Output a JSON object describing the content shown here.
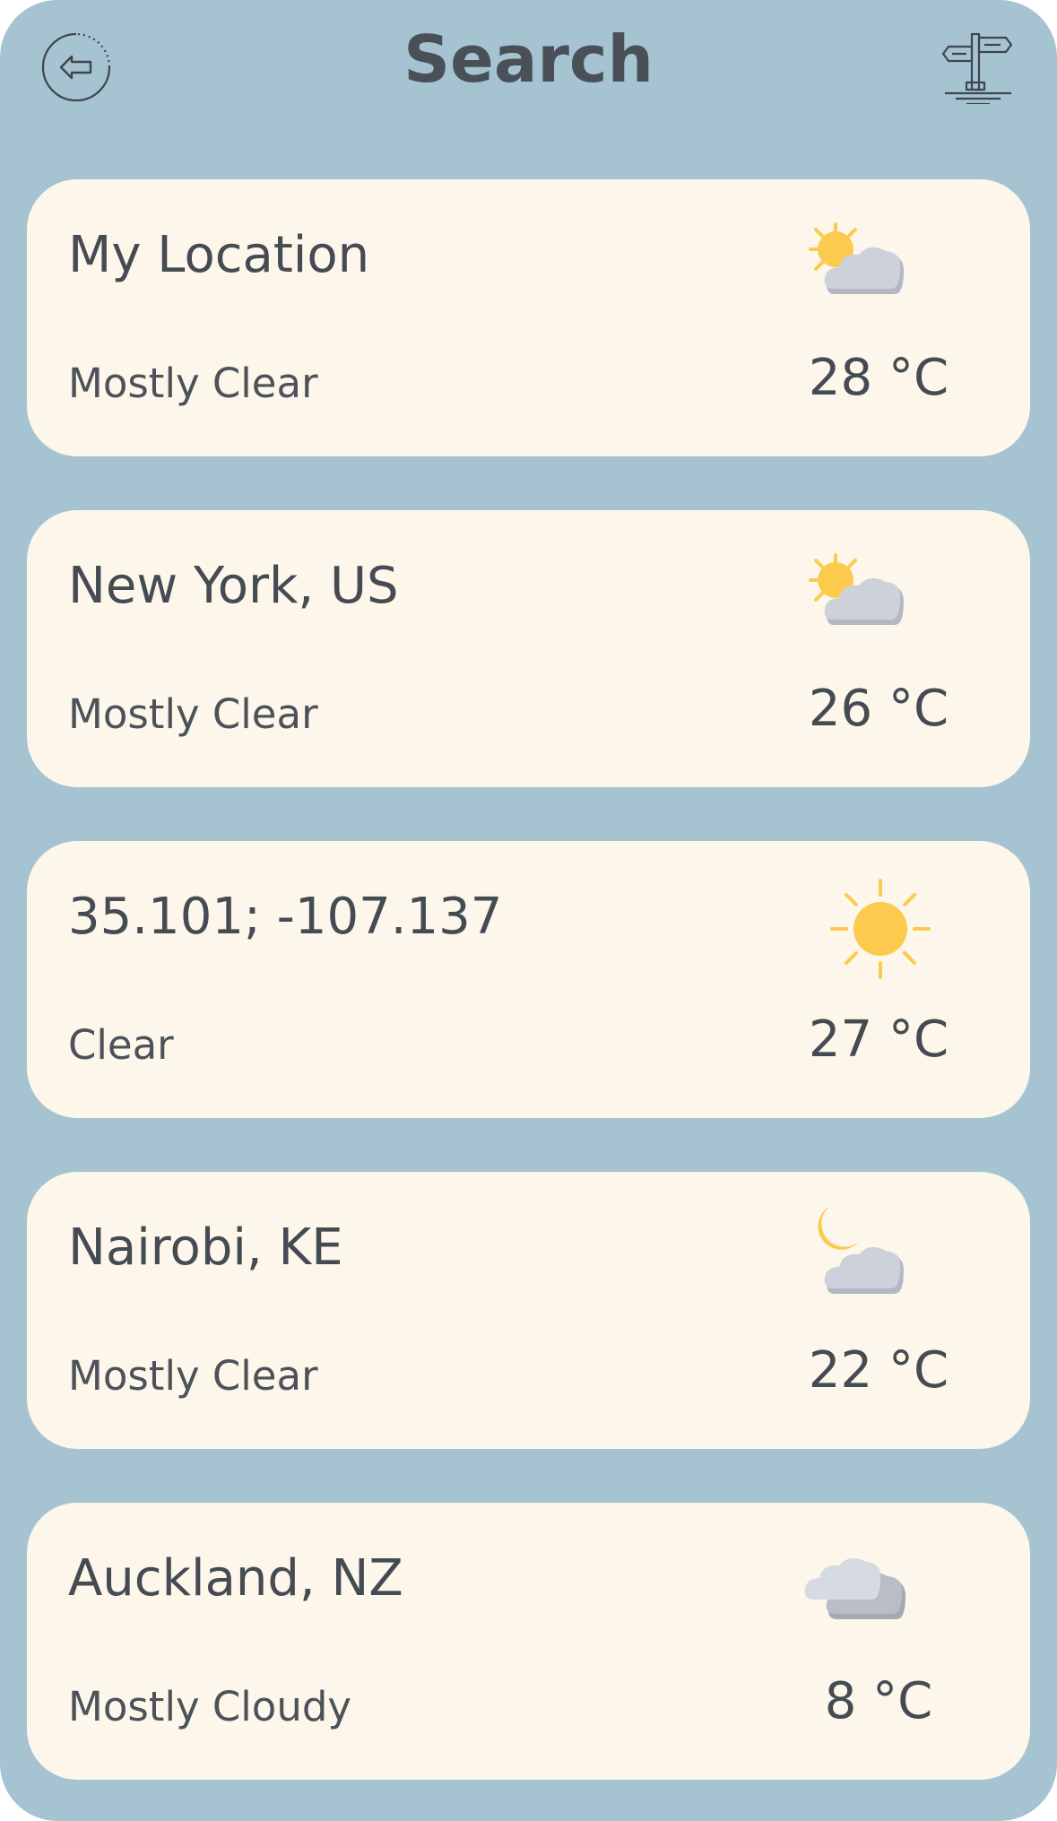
{
  "header": {
    "title": "Search",
    "back_icon": "back-arrow-circle-icon",
    "right_icon": "signpost-icon"
  },
  "colors": {
    "background": "#a5c3d1",
    "card": "#fdf6ea",
    "text": "#454b53",
    "sun": "#fccb4e",
    "cloud": "#cdd2da",
    "cloud_shadow": "#b3b8c4"
  },
  "locations": [
    {
      "name": "My Location",
      "condition": "Mostly Clear",
      "temperature": "28 °C",
      "icon": "partly-cloudy-day-icon"
    },
    {
      "name": "New York, US",
      "condition": "Mostly Clear",
      "temperature": "26 °C",
      "icon": "partly-cloudy-day-icon"
    },
    {
      "name": "35.101; -107.137",
      "condition": "Clear",
      "temperature": "27 °C",
      "icon": "sun-icon"
    },
    {
      "name": "Nairobi, KE",
      "condition": "Mostly Clear",
      "temperature": "22 °C",
      "icon": "partly-cloudy-night-icon"
    },
    {
      "name": "Auckland, NZ",
      "condition": "Mostly Cloudy",
      "temperature": "8 °C",
      "icon": "cloudy-icon"
    }
  ]
}
